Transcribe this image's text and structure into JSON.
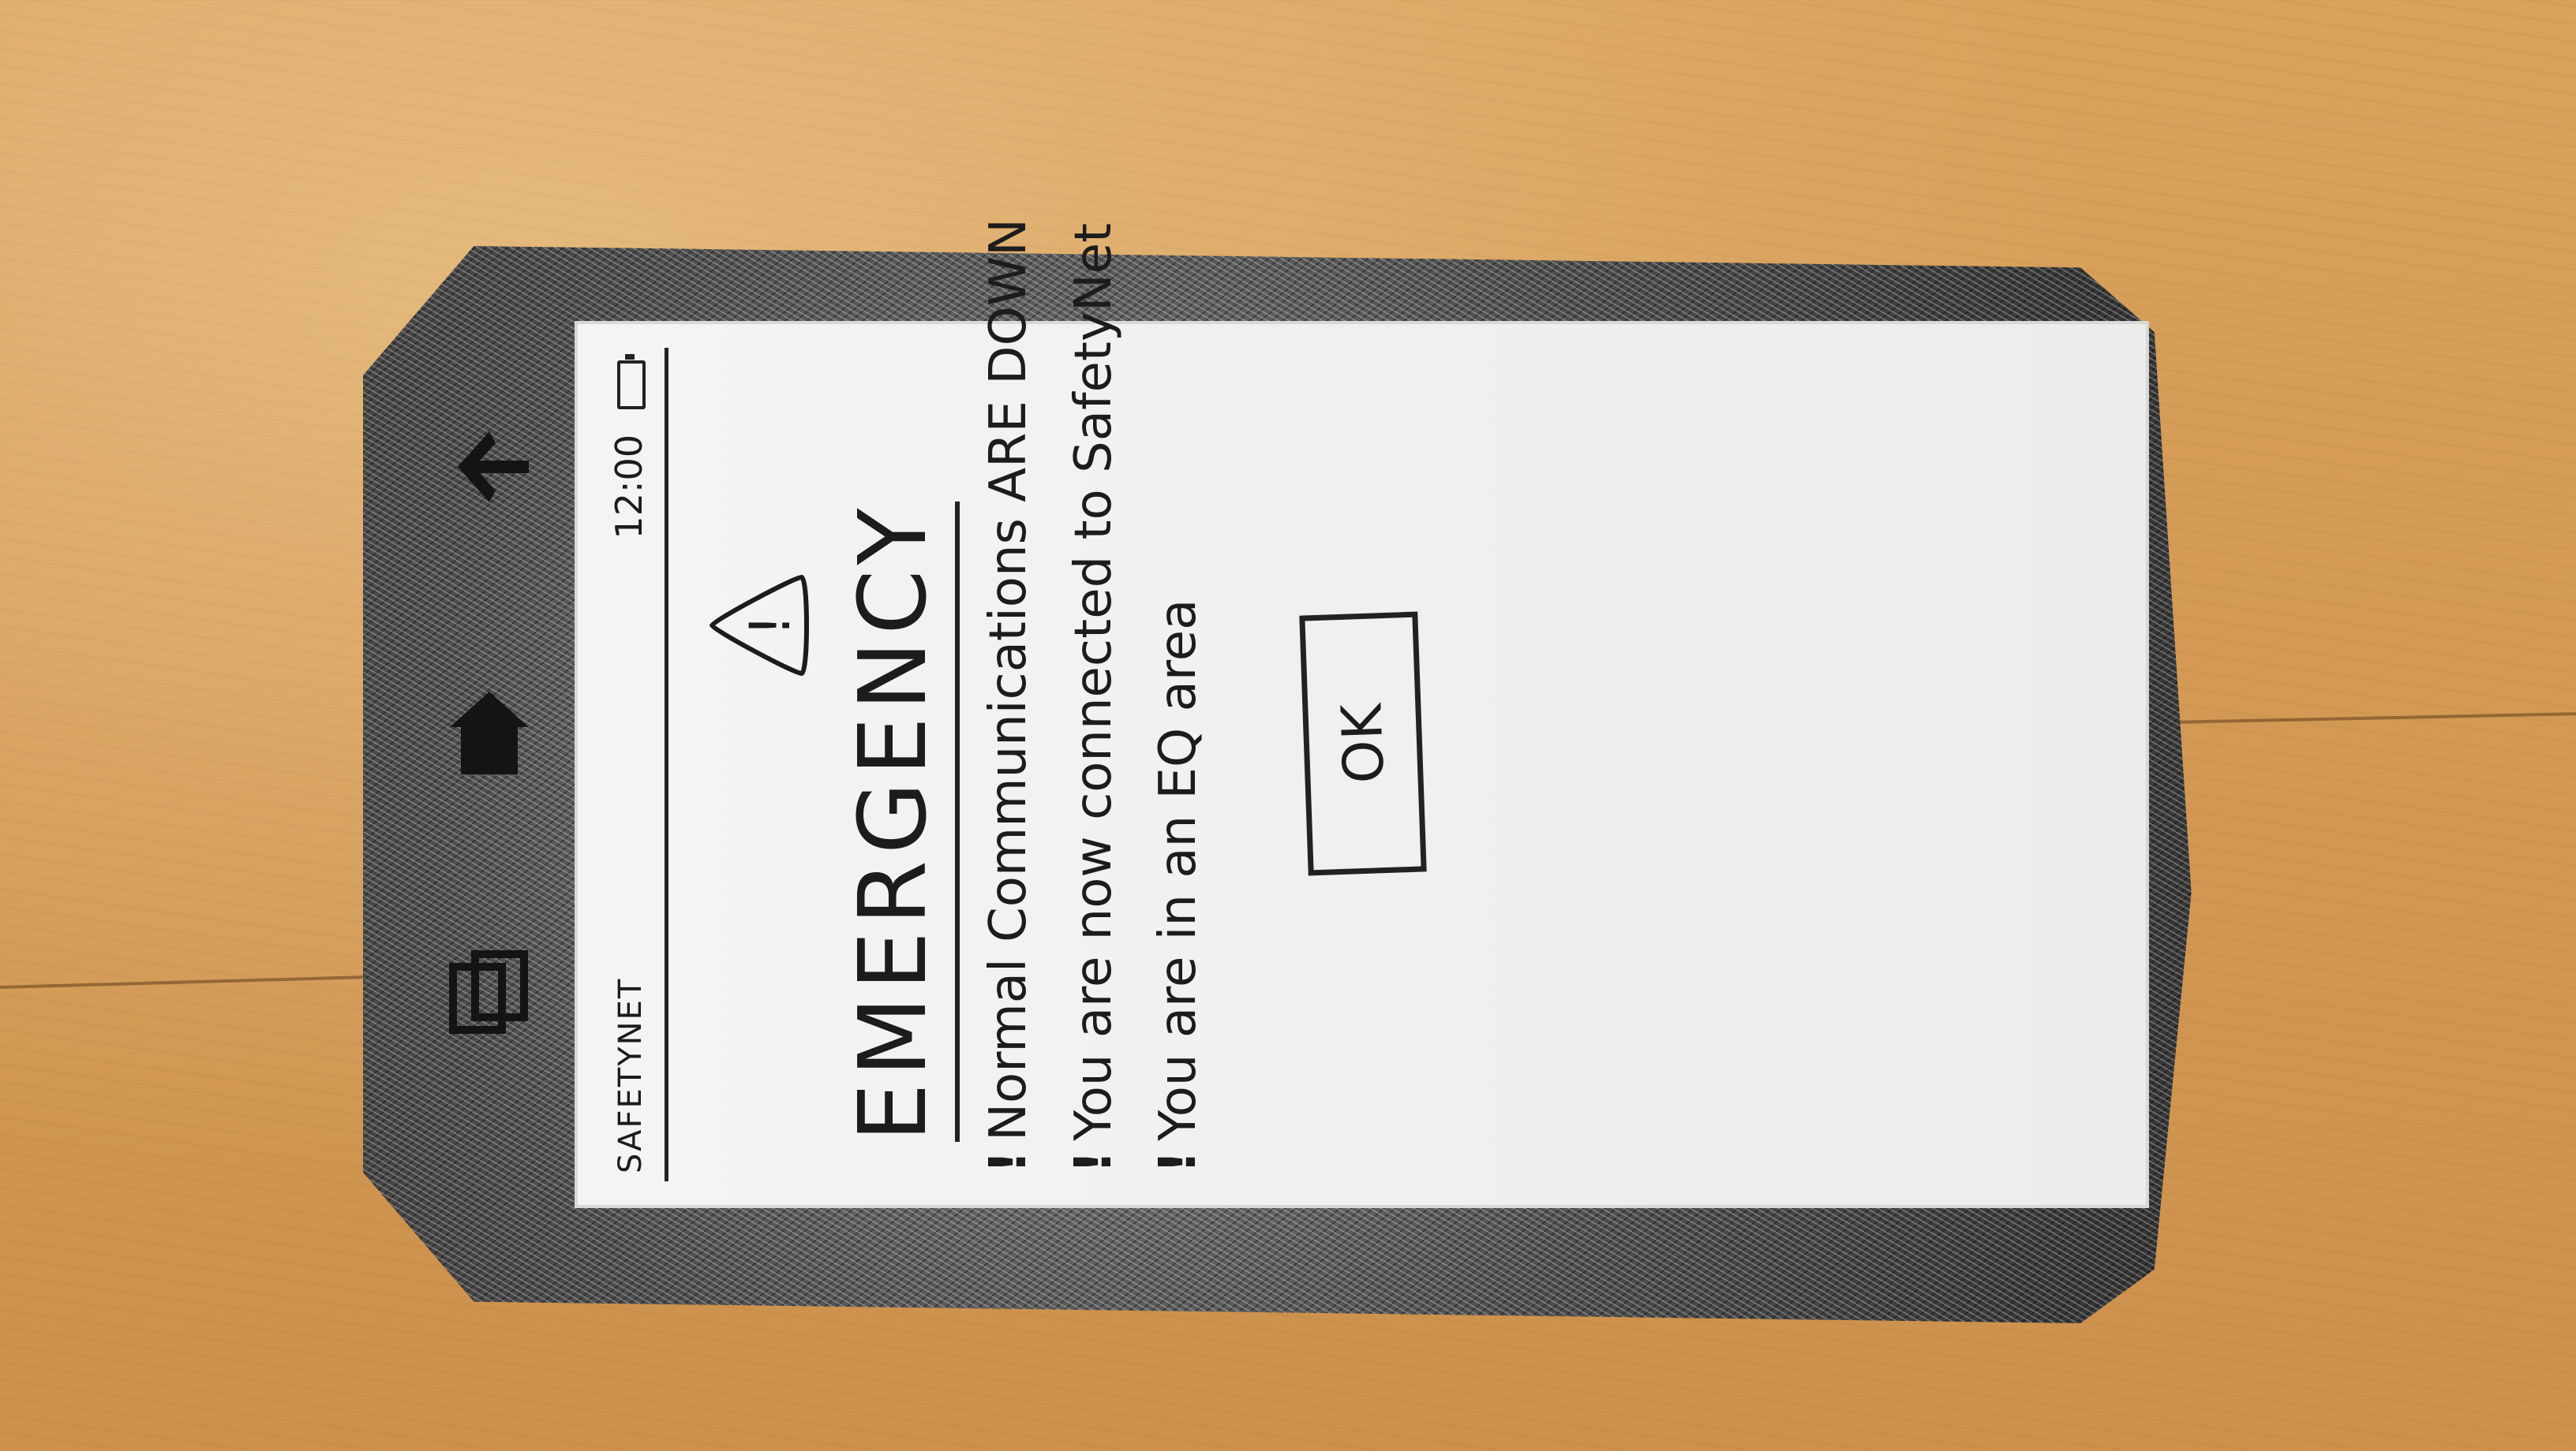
{
  "status_bar": {
    "carrier": "SAFETYNET",
    "time": "12:00",
    "battery_icon": "battery-icon"
  },
  "alert": {
    "icon": "warning-triangle-icon",
    "icon_glyph": "!",
    "title": "EMERGENCY",
    "messages": [
      {
        "bullet": "!",
        "text": "Normal Communications ARE DOWN"
      },
      {
        "bullet": "!",
        "text": "You are now connected to SafetyNet"
      },
      {
        "bullet": "!",
        "text": "You are in an EQ area"
      }
    ],
    "ok_label": "OK"
  },
  "nav_bar": {
    "back_icon": "back-arrow-icon",
    "home_icon": "home-icon",
    "recent_icon": "recent-apps-icon"
  }
}
